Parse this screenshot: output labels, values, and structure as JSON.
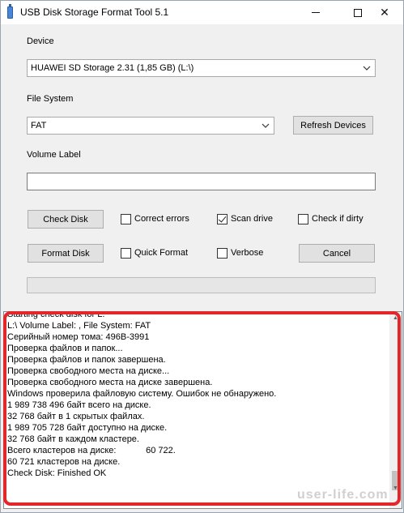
{
  "window": {
    "title": "USB Disk Storage Format Tool 5.1"
  },
  "labels": {
    "device": "Device",
    "file_system": "File System",
    "volume_label": "Volume Label"
  },
  "device_select": {
    "value": "HUAWEI  SD Storage  2.31 (1,85 GB) (L:\\)"
  },
  "fs_select": {
    "value": "FAT"
  },
  "volume_label_input": {
    "value": ""
  },
  "buttons": {
    "refresh": "Refresh Devices",
    "check_disk": "Check Disk",
    "format_disk": "Format Disk",
    "cancel": "Cancel"
  },
  "checkboxes": {
    "correct_errors": {
      "label": "Correct errors",
      "checked": false
    },
    "scan_drive": {
      "label": "Scan drive",
      "checked": true
    },
    "check_if_dirty": {
      "label": "Check if dirty",
      "checked": false
    },
    "quick_format": {
      "label": "Quick Format",
      "checked": false
    },
    "verbose": {
      "label": "Verbose",
      "checked": false
    }
  },
  "progress": {
    "value_percent": 0
  },
  "log": {
    "lines": [
      "Starting check disk for L:",
      "L:\\ Volume Label: , File System: FAT",
      "Серийный номер тома: 496B-3991",
      "Проверка файлов и папок...",
      "Проверка файлов и папок завершена.",
      "Проверка свободного места на диске...",
      "Проверка свободного места на диске завершена.",
      "Windows проверила файловую систему. Ошибок не обнаружено.",
      "1 989 738 496 байт всего на диске.",
      "32 768 байт в 1 скрытых файлах.",
      "1 989 705 728 байт доступно на диске.",
      "32 768 байт в каждом кластере.",
      "Всего кластеров на диске:            60 722.",
      "60 721 кластеров на диске.",
      "Check Disk: Finished OK"
    ]
  },
  "watermark": "user-life.com",
  "colors": {
    "highlight": "#e2262a",
    "window_bg": "#f0f0f0"
  }
}
